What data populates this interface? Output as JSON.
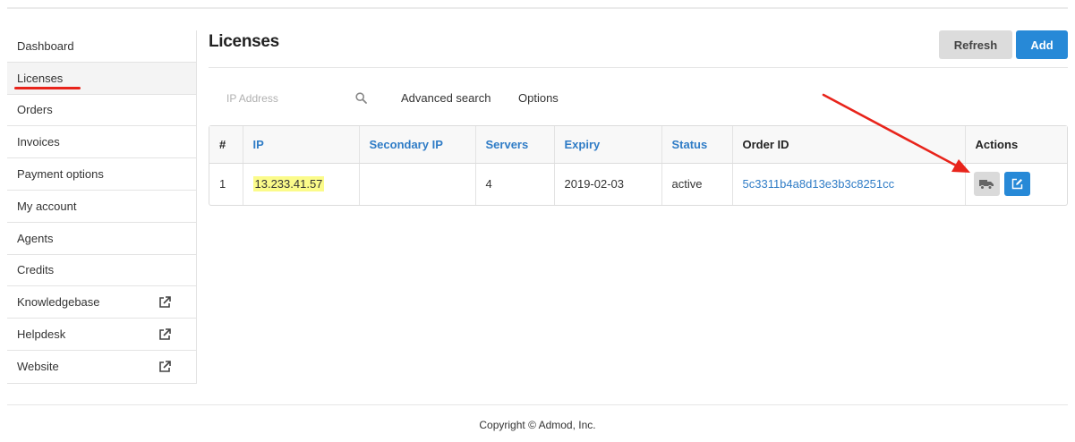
{
  "sidebar": {
    "items": [
      {
        "label": "Dashboard",
        "external": false
      },
      {
        "label": "Licenses",
        "external": false
      },
      {
        "label": "Orders",
        "external": false
      },
      {
        "label": "Invoices",
        "external": false
      },
      {
        "label": "Payment options",
        "external": false
      },
      {
        "label": "My account",
        "external": false
      },
      {
        "label": "Agents",
        "external": false
      },
      {
        "label": "Credits",
        "external": false
      },
      {
        "label": "Knowledgebase",
        "external": true
      },
      {
        "label": "Helpdesk",
        "external": true
      },
      {
        "label": "Website",
        "external": true
      }
    ],
    "active_index": 1
  },
  "header": {
    "title": "Licenses",
    "refresh_label": "Refresh",
    "add_label": "Add"
  },
  "search": {
    "placeholder": "IP Address",
    "value": "",
    "advanced_label": "Advanced search",
    "options_label": "Options"
  },
  "table": {
    "columns": [
      "#",
      "IP",
      "Secondary IP",
      "Servers",
      "Expiry",
      "Status",
      "Order ID",
      "Actions"
    ],
    "rows": [
      {
        "num": "1",
        "ip": "13.233.41.57",
        "secondary_ip": "",
        "servers": "4",
        "expiry": "2019-02-03",
        "status": "active",
        "order_id": "5c3311b4a8d13e3b3c8251cc"
      }
    ]
  },
  "icons": {
    "external_link": "external-link-icon",
    "search": "search-icon",
    "truck": "truck-icon",
    "edit": "edit-icon"
  },
  "colors": {
    "primary": "#2789d7",
    "link": "#2f7cc6",
    "highlight": "#fbfb8a",
    "annotation": "#e8241b"
  },
  "footer": {
    "copyright": "Copyright © Admod, Inc."
  }
}
